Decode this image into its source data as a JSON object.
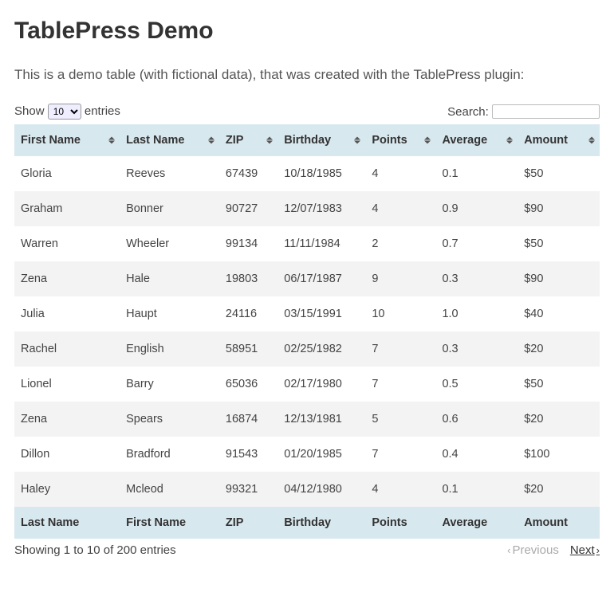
{
  "page": {
    "title": "TablePress Demo",
    "intro": "This is a demo table (with fictional data), that was created with the TablePress plugin:"
  },
  "controls": {
    "show_label_pre": "Show",
    "show_label_post": "entries",
    "show_value": "10",
    "search_label": "Search:",
    "search_value": ""
  },
  "table": {
    "head": [
      "First Name",
      "Last Name",
      "ZIP",
      "Birthday",
      "Points",
      "Average",
      "Amount"
    ],
    "foot": [
      "Last Name",
      "First Name",
      "ZIP",
      "Birthday",
      "Points",
      "Average",
      "Amount"
    ],
    "rows": [
      {
        "first": "Gloria",
        "last": "Reeves",
        "zip": "67439",
        "bday": "10/18/1985",
        "points": "4",
        "avg": "0.1",
        "amt": "$50"
      },
      {
        "first": "Graham",
        "last": "Bonner",
        "zip": "90727",
        "bday": "12/07/1983",
        "points": "4",
        "avg": "0.9",
        "amt": "$90"
      },
      {
        "first": "Warren",
        "last": "Wheeler",
        "zip": "99134",
        "bday": "11/11/1984",
        "points": "2",
        "avg": "0.7",
        "amt": "$50"
      },
      {
        "first": "Zena",
        "last": "Hale",
        "zip": "19803",
        "bday": "06/17/1987",
        "points": "9",
        "avg": "0.3",
        "amt": "$90"
      },
      {
        "first": "Julia",
        "last": "Haupt",
        "zip": "24116",
        "bday": "03/15/1991",
        "points": "10",
        "avg": "1.0",
        "amt": "$40"
      },
      {
        "first": "Rachel",
        "last": "English",
        "zip": "58951",
        "bday": "02/25/1982",
        "points": "7",
        "avg": "0.3",
        "amt": "$20"
      },
      {
        "first": "Lionel",
        "last": "Barry",
        "zip": "65036",
        "bday": "02/17/1980",
        "points": "7",
        "avg": "0.5",
        "amt": "$50"
      },
      {
        "first": "Zena",
        "last": "Spears",
        "zip": "16874",
        "bday": "12/13/1981",
        "points": "5",
        "avg": "0.6",
        "amt": "$20"
      },
      {
        "first": "Dillon",
        "last": "Bradford",
        "zip": "91543",
        "bday": "01/20/1985",
        "points": "7",
        "avg": "0.4",
        "amt": "$100"
      },
      {
        "first": "Haley",
        "last": "Mcleod",
        "zip": "99321",
        "bday": "04/12/1980",
        "points": "4",
        "avg": "0.1",
        "amt": "$20"
      }
    ]
  },
  "footer": {
    "info": "Showing 1 to 10 of 200 entries",
    "prev": "Previous",
    "next": "Next"
  }
}
